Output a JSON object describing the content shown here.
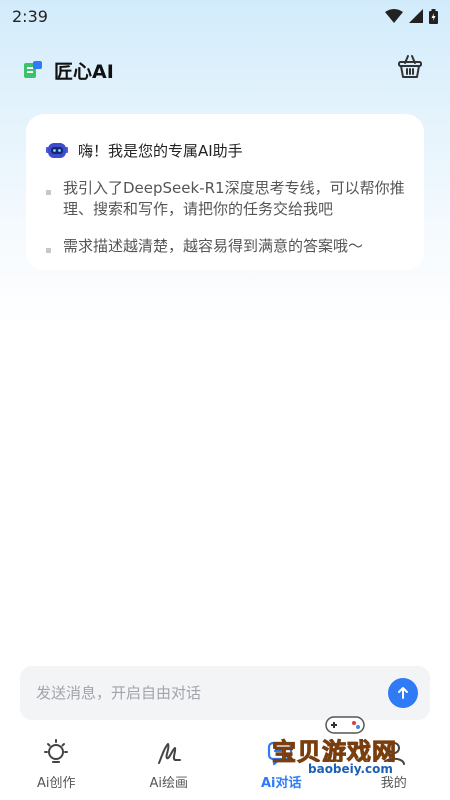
{
  "status_bar": {
    "time": "2:39"
  },
  "app": {
    "title": "匠心AI"
  },
  "greeting": {
    "title": "嗨！我是您的专属AI助手",
    "bullets": [
      "我引入了DeepSeek-R1深度思考专线，可以帮你推理、搜索和写作，请把你的任务交给我吧",
      "需求描述越清楚，越容易得到满意的答案哦～"
    ]
  },
  "input": {
    "placeholder": "发送消息，开启自由对话"
  },
  "tabs": [
    {
      "label": "Ai创作",
      "icon": "bulb-icon",
      "active": false
    },
    {
      "label": "Ai绘画",
      "icon": "brush-icon",
      "active": false
    },
    {
      "label": "Ai对话",
      "icon": "chat-icon",
      "active": true
    },
    {
      "label": "我的",
      "icon": "profile-icon",
      "active": false
    }
  ],
  "watermark": {
    "text": "宝贝游戏网",
    "url": "baobeiy.com"
  },
  "colors": {
    "accent": "#2f7bf5",
    "header_gradient": "#d2ebfb"
  }
}
